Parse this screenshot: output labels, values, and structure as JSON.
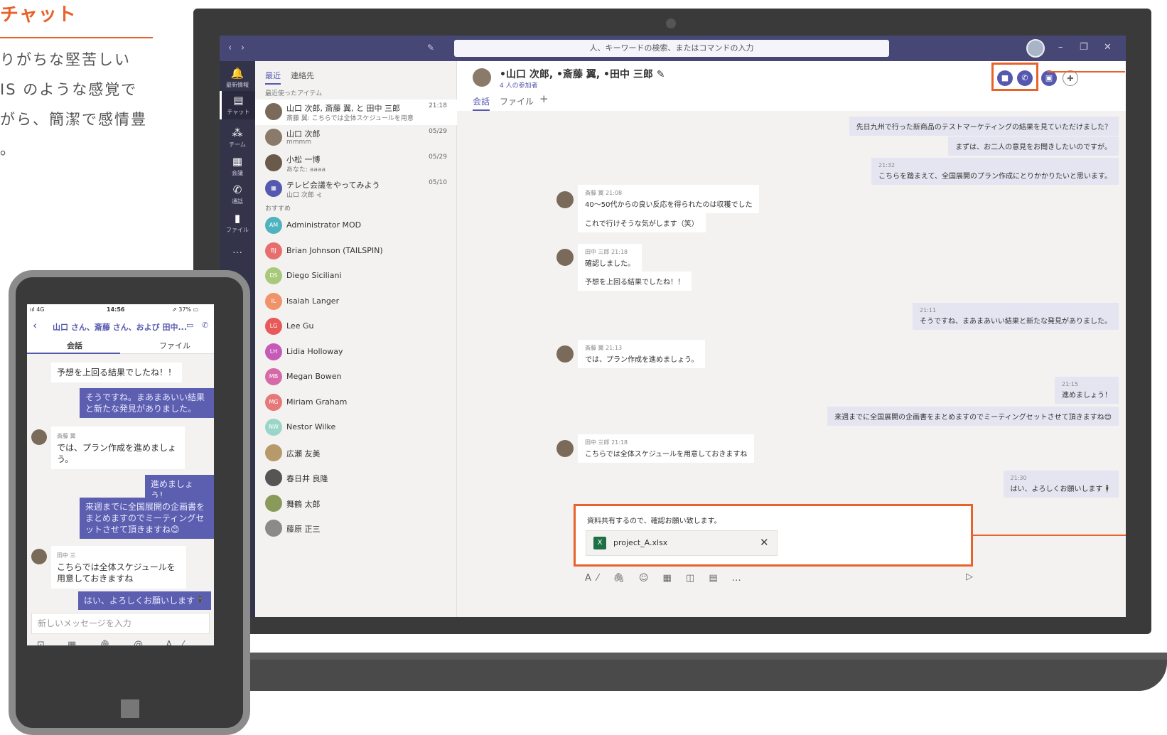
{
  "promo": {
    "title": "チャット",
    "lines": [
      "りがちな堅苦しい",
      "IS のような感覚で",
      "がら、簡潔で感情豊",
      "。"
    ]
  },
  "titlebar": {
    "back": "‹",
    "forward": "›",
    "search_placeholder": "人、キーワードの検索、またはコマンドの入力",
    "minimize": "–",
    "restore": "❐",
    "close": "✕"
  },
  "rail": [
    {
      "icon": "bell-icon",
      "label": "最新情報"
    },
    {
      "icon": "chat-icon",
      "label": "チャット"
    },
    {
      "icon": "team-icon",
      "label": "チーム"
    },
    {
      "icon": "calendar-icon",
      "label": "会議"
    },
    {
      "icon": "phone-icon",
      "label": "通話"
    },
    {
      "icon": "file-icon",
      "label": "ファイル"
    },
    {
      "icon": "more-icon",
      "label": "…"
    }
  ],
  "chatlist": {
    "tabs": [
      "最近",
      "連絡先"
    ],
    "recent_label": "最近使ったアイテム",
    "recent": [
      {
        "name": "山口 次郎, 斎藤 翼, と 田中 三郎",
        "preview": "斎藤 翼: こちらでは全体スケジュールを用意し…",
        "time": "21:18"
      },
      {
        "name": "山口 次郎",
        "preview": "mmmm",
        "time": "05/29"
      },
      {
        "name": "小松 一博",
        "preview": "あなた: aaaa",
        "time": "05/29"
      },
      {
        "name": "テレビ会議をやってみよう",
        "preview": "山口 次郎 ⊰",
        "time": "05/10"
      }
    ],
    "suggest_label": "おすすめ",
    "suggested": [
      {
        "name": "Administrator MOD",
        "initials": "AM",
        "color": "#4fb3bf"
      },
      {
        "name": "Brian Johnson (TAILSPIN)",
        "initials": "BJ",
        "color": "#e86e6e"
      },
      {
        "name": "Diego Siciliani",
        "initials": "DS",
        "color": "#a8c97a"
      },
      {
        "name": "Isaiah Langer",
        "initials": "IL",
        "color": "#f0926a"
      },
      {
        "name": "Lee Gu",
        "initials": "LG",
        "color": "#e85a5a"
      },
      {
        "name": "Lidia Holloway",
        "initials": "LH",
        "color": "#c65ab8"
      },
      {
        "name": "Megan Bowen",
        "initials": "MB",
        "color": "#d66aa8"
      },
      {
        "name": "Miriam Graham",
        "initials": "MG",
        "color": "#e67878"
      },
      {
        "name": "Nestor Wilke",
        "initials": "NW",
        "color": "#9ad6c8"
      },
      {
        "name": "広瀬 友美",
        "initials": "",
        "color": "#b89a6a"
      },
      {
        "name": "春日井 良隆",
        "initials": "",
        "color": "#555555"
      },
      {
        "name": "舞鶴 太郎",
        "initials": "",
        "color": "#8a9a5a"
      },
      {
        "name": "藤原 正三",
        "initials": "",
        "color": "#8a8a8a"
      }
    ]
  },
  "chat": {
    "title": "•山口 次郎, •斎藤 翼, •田中 三郎 ✎",
    "subtitle": "4 人の参加者",
    "tabs": [
      "会話",
      "ファイル",
      "+"
    ],
    "messages_out_1": [
      "先日九州で行った新商品のテストマーケティングの結果を見ていただけました？",
      "まずは、お二人の意見をお聞きしたいのですが。"
    ],
    "out_2_time": "21:32",
    "out_2_text": "こちらを踏まえて、全国展開のプラン作成にとりかかりたいと思います。",
    "in_1_meta": "斎藤 翼  21:08",
    "in_1_text": "40〜50代からの良い反応を得られたのは収穫でした",
    "in_1b_text": "これで行けそうな気がします（笑）",
    "in_2_meta": "田中 三郎  21:18",
    "in_2_text": "確認しました。",
    "in_2b_text": "予想を上回る結果でしたね！！",
    "out_3_time": "21:11",
    "out_3_text": "そうですね、まあまあいい結果と新たな発見がありました。",
    "in_3_meta": "斎藤 翼  21:13",
    "in_3_text": "では、プラン作成を進めましょう。",
    "out_4_time": "21:15",
    "out_4_text": "進めましょう！",
    "out_4b_text": "来週までに全国展開の企画書をまとめますのでミーティングセットさせて頂きますね😊",
    "in_4_meta": "田中 三郎  21:18",
    "in_4_text": "こちらでは全体スケジュールを用意しておきますね",
    "out_5_time": "21:30",
    "out_5_text": "はい、よろしくお願いします🕴"
  },
  "compose": {
    "text": "資料共有するので、確認お願い致します。",
    "attachment": "project_A.xlsx",
    "attachment_close": "✕",
    "tools": "A⁄ 🖇 ☺ ▦ ◫ ▤ …",
    "send": "▷"
  },
  "phone": {
    "status_left": "ııl 4G",
    "status_time": "14:56",
    "status_right": "⇗ 37% ▭",
    "header": "山口 さん、斎藤 さん、および 田中...",
    "tabs": [
      "会話",
      "ファイル"
    ],
    "msg1": "予想を上回る結果でしたね！！",
    "msg2": "そうですね。まあまあいい結果と新たな発見がありました。",
    "msg3_meta": "斎藤 翼",
    "msg3": "では、プラン作成を進めましょう。",
    "msg4": "進めましょう！",
    "msg5": "来週までに全国展開の企画書をまとめますのでミーティングセットさせて頂きますね😊",
    "msg6_meta": "田中 三",
    "msg6": "こちらでは全体スケジュールを用意しておきますね",
    "msg7": "はい、よろしくお願いします🕴",
    "input_placeholder": "新しいメッセージを入力",
    "tools": "⊡ ▦ 🖇 @ A⁄ …",
    "mic": "🎙"
  },
  "colors": {
    "accent": "#e8622a",
    "teams": "#464775",
    "bubble_out": "#e5e5f1"
  }
}
